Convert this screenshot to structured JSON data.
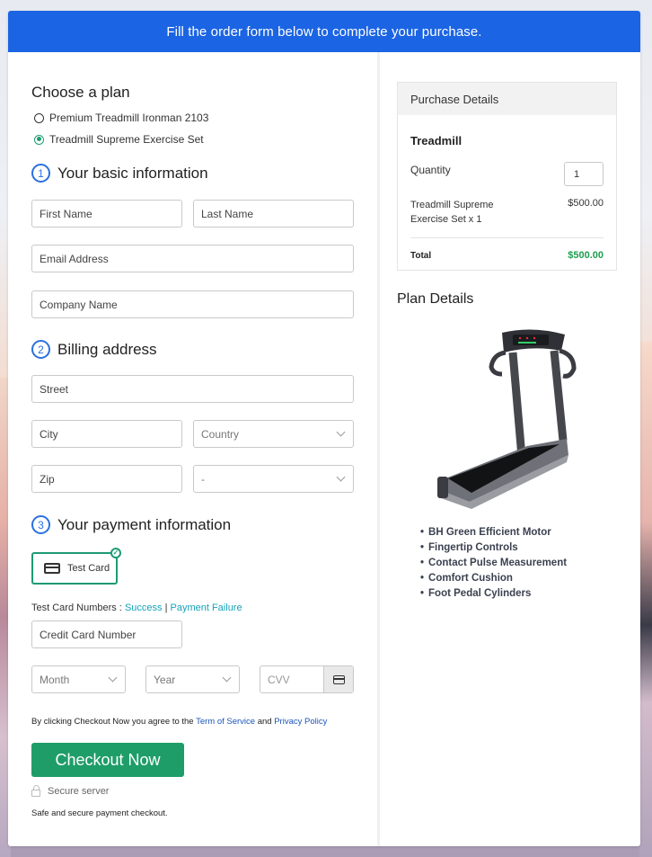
{
  "banner": {
    "text": "Fill the order form below to complete your purchase."
  },
  "plan": {
    "title": "Choose a plan",
    "options": [
      {
        "label": "Premium Treadmill Ironman 2103",
        "selected": false
      },
      {
        "label": "Treadmill Supreme Exercise Set",
        "selected": true
      }
    ]
  },
  "basic_info": {
    "step": "1",
    "title": "Your basic information",
    "first_name_placeholder": "First Name",
    "last_name_placeholder": "Last Name",
    "email_placeholder": "Email Address",
    "company_placeholder": "Company Name"
  },
  "billing": {
    "step": "2",
    "title": "Billing address",
    "street_placeholder": "Street",
    "city_placeholder": "City",
    "country_value": "Country",
    "zip_placeholder": "Zip",
    "state_value": "-"
  },
  "payment": {
    "step": "3",
    "title": "Your payment information",
    "method_label": "Test Card",
    "test_numbers_label": "Test Card Numbers :",
    "success_link": "Success",
    "separator": "|",
    "failure_link": "Payment Failure",
    "card_number_placeholder": "Credit Card Number",
    "month_value": "Month",
    "year_value": "Year",
    "cvv_placeholder": "CVV"
  },
  "agreement": {
    "prefix": "By clicking Checkout Now you agree to the",
    "tos_link": "Term of Service",
    "and": "and",
    "privacy_link": "Privacy Policy"
  },
  "checkout_button": "Checkout Now",
  "secure_label": "Secure server",
  "safe_text": "Safe and secure payment checkout.",
  "purchase": {
    "title": "Purchase Details",
    "product": "Treadmill",
    "quantity_label": "Quantity",
    "quantity_value": "1",
    "item_name": "Treadmill Supreme Exercise Set x 1",
    "item_price": "$500.00",
    "total_label": "Total",
    "total_value": "$500.00"
  },
  "plan_details": {
    "title": "Plan Details",
    "features": [
      "BH Green Efficient Motor",
      "Fingertip Controls",
      "Contact Pulse Measurement",
      "Comfort Cushion",
      "Foot Pedal Cylinders"
    ]
  },
  "colors": {
    "brand_blue": "#1b64e3",
    "accent_green": "#1e9d68",
    "total_green": "#1e9d4e",
    "link_teal": "#16a2b8"
  }
}
